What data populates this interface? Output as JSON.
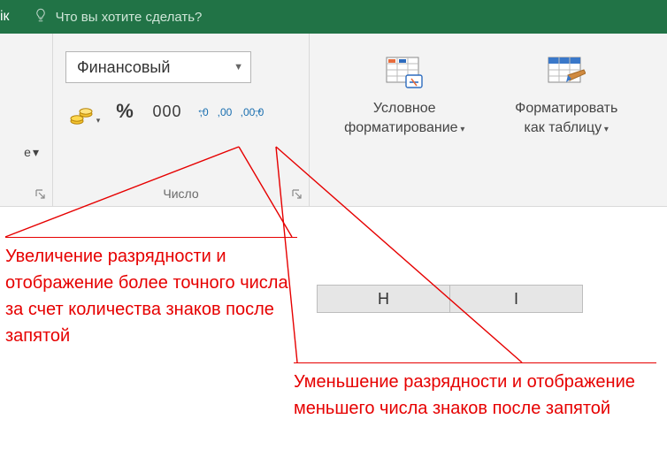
{
  "titlebar": {
    "tab_end_text": "ік",
    "tell_me": "Что вы хотите сделать?"
  },
  "number_group": {
    "format_selected": "Финансовый",
    "label": "Число",
    "currency_tip": "Финансовый формат",
    "percent_tip": "Процентный формат",
    "thousand_tip": "Формат с разделителями",
    "increase_tip": "Увеличить разрядность",
    "decrease_tip": "Уменьшить разрядность",
    "percent_glyph": "%",
    "thousand_glyph": "000"
  },
  "styles_group": {
    "cond_format_line1": "Условное",
    "cond_format_line2": "форматирование",
    "format_table_line1": "Форматировать",
    "format_table_line2": "как таблицу"
  },
  "columns": {
    "h": "H",
    "i": "I"
  },
  "annotations": {
    "increase": "Увеличение разрядности и отображение более точного числа за счет количества знаков после запятой",
    "decrease": "Уменьшение разрядности и отображение меньшего числа знаков после запятой"
  }
}
